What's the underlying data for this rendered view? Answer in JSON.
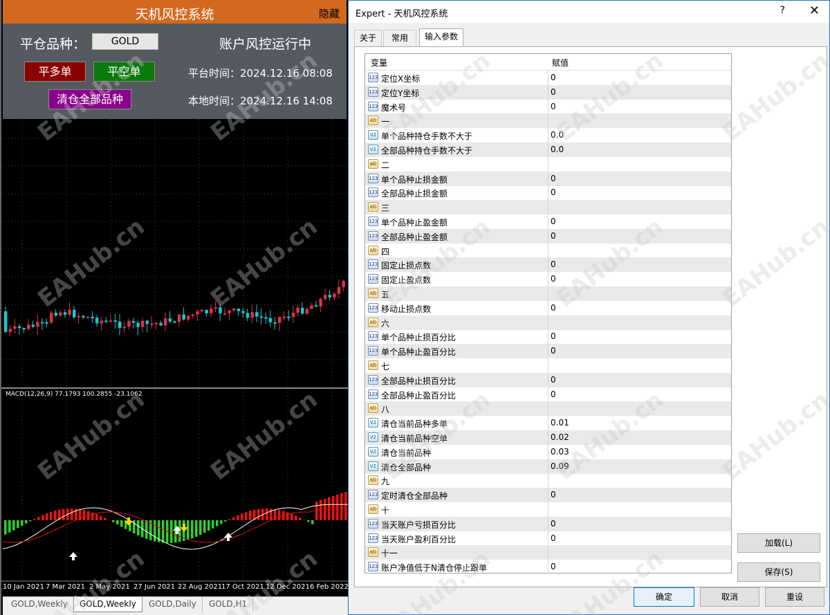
{
  "panel": {
    "title": "天机风控系统",
    "hide_label": "隐藏",
    "symbol_label": "平仓品种：",
    "symbol_value": "GOLD",
    "status_text": "账户风控运行中",
    "close_long_label": "平多单",
    "close_short_label": "平空单",
    "close_all_label": "清仓全部品种",
    "platform_time": "平台时间：2024.12.16 08:08",
    "local_time": "本地时间：2024.12.16 14:08"
  },
  "indicator_label": "MACD(12,26,9) 77.1793 100.2855 -23.1062",
  "date_axis": [
    "10 Jan 2021",
    "7 Mar 2021",
    "2 May 2021",
    "27 Jun 2021",
    "22 Aug 2021",
    "17 Oct 2021",
    "12 Dec 2021",
    "6 Feb 2022"
  ],
  "chart_tabs": [
    "GOLD,Weekly",
    "GOLD,Weekly",
    "GOLD,Daily",
    "GOLD,H1"
  ],
  "watermark": "EAHub.cn",
  "dialog": {
    "title": "Expert - 天机风控系统",
    "help_glyph": "?",
    "close_glyph": "✕",
    "tabs": [
      "关于",
      "常用",
      "输入参数"
    ],
    "col_variable": "变量",
    "col_value": "赋值",
    "rows": [
      {
        "type": "123",
        "name": "定位X坐标",
        "value": "0"
      },
      {
        "type": "123",
        "name": "定位Y坐标",
        "value": "0"
      },
      {
        "type": "123",
        "name": "魔术号",
        "value": "0"
      },
      {
        "type": "ab",
        "name": "一",
        "value": ""
      },
      {
        "type": "va",
        "name": "单个品种持仓手数不大于",
        "value": "0.0"
      },
      {
        "type": "va",
        "name": "全部品种持仓手数不大于",
        "value": "0.0"
      },
      {
        "type": "ab",
        "name": "二",
        "value": ""
      },
      {
        "type": "123",
        "name": "单个品种止损金额",
        "value": "0"
      },
      {
        "type": "123",
        "name": "全部品种止损金额",
        "value": "0"
      },
      {
        "type": "ab",
        "name": "三",
        "value": ""
      },
      {
        "type": "123",
        "name": "单个品种止盈金额",
        "value": "0"
      },
      {
        "type": "123",
        "name": "全部品种止盈金额",
        "value": "0"
      },
      {
        "type": "ab",
        "name": "四",
        "value": ""
      },
      {
        "type": "123",
        "name": "固定止损点数",
        "value": "0"
      },
      {
        "type": "123",
        "name": "固定止盈点数",
        "value": "0"
      },
      {
        "type": "ab",
        "name": "五",
        "value": ""
      },
      {
        "type": "123",
        "name": "移动止损点数",
        "value": "0"
      },
      {
        "type": "ab",
        "name": "六",
        "value": ""
      },
      {
        "type": "123",
        "name": "单个品种止损百分比",
        "value": "0"
      },
      {
        "type": "123",
        "name": "单个品种止盈百分比",
        "value": "0"
      },
      {
        "type": "ab",
        "name": "七",
        "value": ""
      },
      {
        "type": "123",
        "name": "全部品种止损百分比",
        "value": "0"
      },
      {
        "type": "123",
        "name": "全部品种止盈百分比",
        "value": "0"
      },
      {
        "type": "ab",
        "name": "八",
        "value": ""
      },
      {
        "type": "va",
        "name": "清仓当前品种多单",
        "value": "0.01"
      },
      {
        "type": "va",
        "name": "清仓当前品种空单",
        "value": "0.02"
      },
      {
        "type": "va",
        "name": "清仓当前品种",
        "value": "0.03"
      },
      {
        "type": "va",
        "name": "清仓全部品种",
        "value": "0.09"
      },
      {
        "type": "ab",
        "name": "九",
        "value": ""
      },
      {
        "type": "123",
        "name": "定时清仓全部品种",
        "value": "0"
      },
      {
        "type": "ab",
        "name": "十",
        "value": ""
      },
      {
        "type": "123",
        "name": "当天账户亏损百分比",
        "value": "0"
      },
      {
        "type": "123",
        "name": "当天账户盈利百分比",
        "value": "0"
      },
      {
        "type": "ab",
        "name": "十一",
        "value": ""
      },
      {
        "type": "123",
        "name": "账户净值低于N清仓停止跟单",
        "value": "0"
      }
    ],
    "load_label": "加载(L)",
    "save_label": "保存(S)",
    "ok_label": "确定",
    "cancel_label": "取消",
    "reset_label": "重设"
  }
}
